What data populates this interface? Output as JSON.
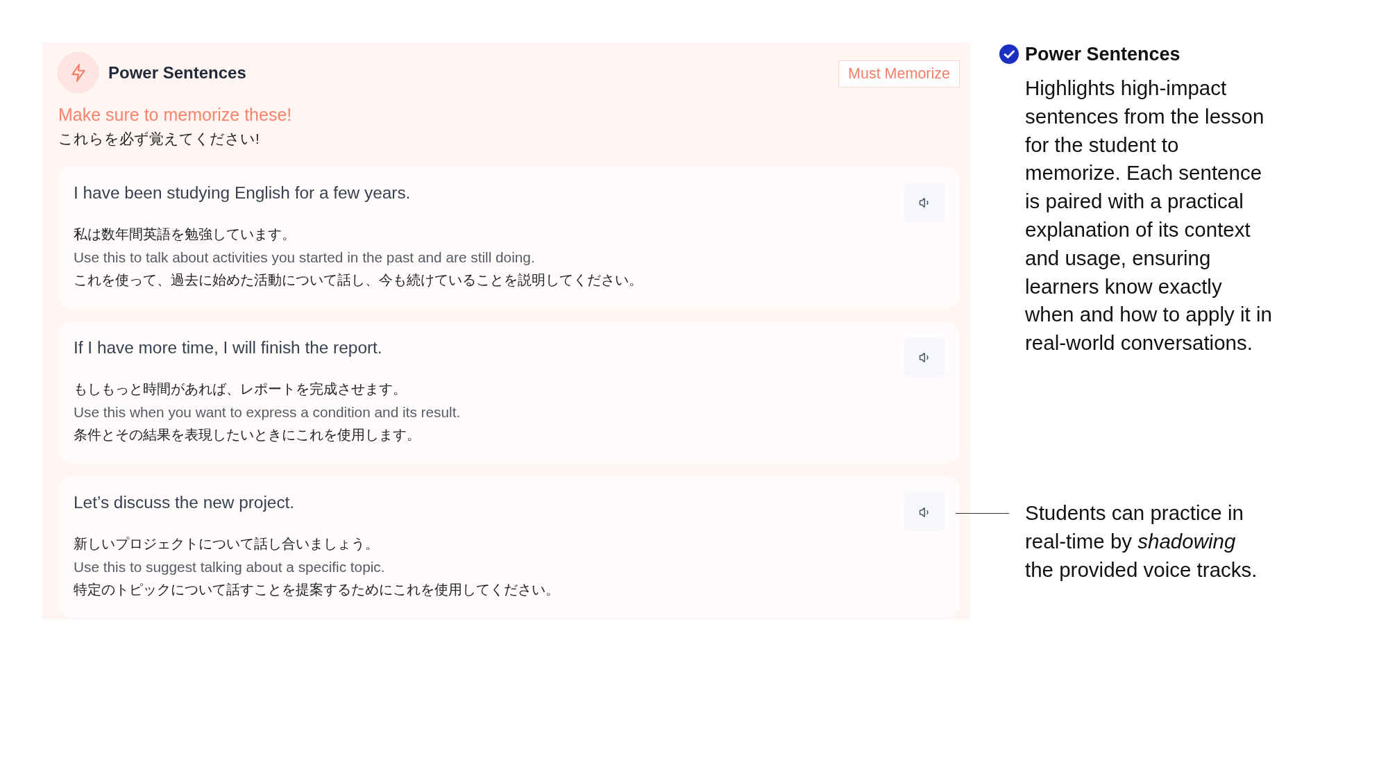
{
  "panel": {
    "title": "Power Sentences",
    "badge": "Must Memorize",
    "heading": "Make sure to memorize these!",
    "heading_translation": "これらを必ず覚えてください!",
    "sentences": [
      {
        "english": "I have been studying English for a few years.",
        "japanese": "私は数年間英語を勉強しています。",
        "usage": "Use this to talk about activities you started in the past and are still doing.",
        "usage_japanese": "これを使って、過去に始めた活動について話し、今も続けていることを説明してください。"
      },
      {
        "english": "If I have more time, I will finish the report.",
        "japanese": "もしもっと時間があれば、レポートを完成させます。",
        "usage": "Use this when you want to express a condition and its result.",
        "usage_japanese": "条件とその結果を表現したいときにこれを使用します。"
      },
      {
        "english": "Let’s discuss the new project.",
        "japanese": "新しいプロジェクトについて話し合いましょう。",
        "usage": "Use this to suggest talking about a specific topic.",
        "usage_japanese": "特定のトピックについて話すことを提案するためにこれを使用してください。"
      }
    ]
  },
  "annotations": [
    {
      "kind": "titled",
      "title": "Power Sentences",
      "text": "Highlights high-impact sentences from the lesson for the student to memorize. Each sentence is paired with a practical explanation of its context and usage, ensuring learners know exactly when and how to apply it in real-world conversations."
    },
    {
      "kind": "pointer",
      "text": "Students can practice in real-time by *shadowing* the provided voice tracks."
    }
  ]
}
